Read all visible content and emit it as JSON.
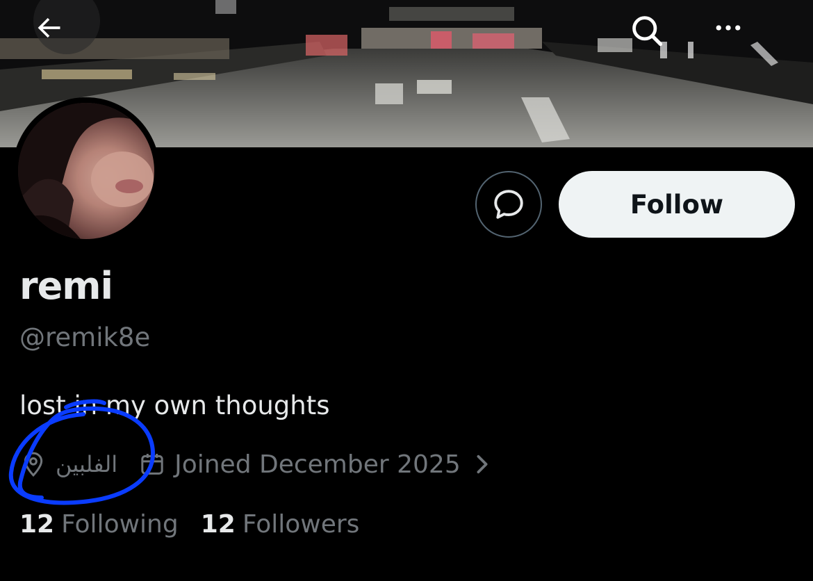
{
  "colors": {
    "background": "#000000",
    "primary_text": "#e7e9ea",
    "secondary_text": "#71767b",
    "follow_button_bg": "#eff3f4",
    "follow_button_text": "#0f1419",
    "annotation_circle": "#0a3cff"
  },
  "header": {
    "back_icon": "arrow-left-icon",
    "search_icon": "search-icon",
    "more_icon": "more-horizontal-icon"
  },
  "actions": {
    "message_icon": "message-bubble-icon",
    "follow_label": "Follow"
  },
  "profile": {
    "display_name": "remi",
    "handle": "@remik8e",
    "bio": "lost in my own thoughts",
    "location_icon": "location-pin-icon",
    "location": "الفلبين",
    "joined_icon": "calendar-icon",
    "joined": "Joined December 2025",
    "joined_chevron_icon": "chevron-right-icon"
  },
  "stats": {
    "following_count": "12",
    "following_label": "Following",
    "followers_count": "12",
    "followers_label": "Followers"
  }
}
